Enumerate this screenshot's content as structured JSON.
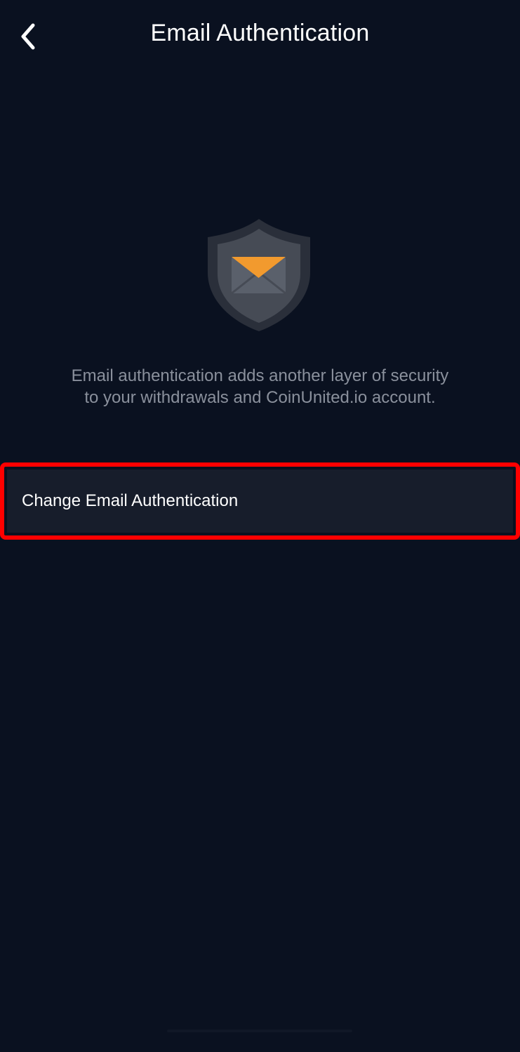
{
  "header": {
    "title": "Email Authentication",
    "back_icon": "chevron-left-icon"
  },
  "hero": {
    "icon": "shield-envelope-icon",
    "colors": {
      "shield_outer": "#2a2f3a",
      "shield_inner": "#464b55",
      "envelope_body": "#5a606b",
      "envelope_flap": "#f29a2e"
    }
  },
  "description": {
    "line1": "Email authentication adds another layer of security",
    "line2": "to your withdrawals and CoinUnited.io account."
  },
  "options": [
    {
      "label": "Change Email Authentication"
    }
  ],
  "theme": {
    "background": "#0a1120",
    "row_background": "#171d2b",
    "highlight_border": "#ff0000",
    "muted_text": "#8a909c"
  }
}
